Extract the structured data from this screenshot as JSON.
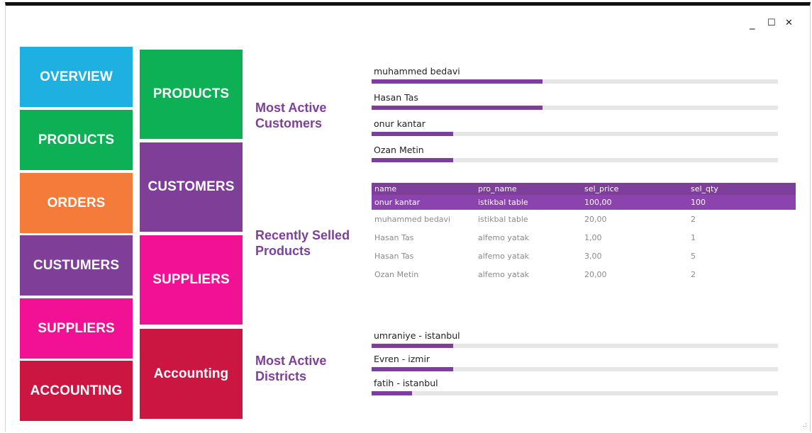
{
  "window_controls": {
    "minimize": "_",
    "maximize": "☐",
    "close": "✕"
  },
  "nav_left": [
    {
      "label": "OVERVIEW",
      "color": "#1fb0e2"
    },
    {
      "label": "PRODUCTS",
      "color": "#0eb055"
    },
    {
      "label": "ORDERS",
      "color": "#f47b3a"
    },
    {
      "label": "CUSTUMERS",
      "color": "#7f3f99"
    },
    {
      "label": "SUPPLIERS",
      "color": "#f21194"
    },
    {
      "label": "ACCOUNTING",
      "color": "#cc1642"
    }
  ],
  "nav_right": [
    {
      "label": "PRODUCTS",
      "color": "#0eb055"
    },
    {
      "label": "CUSTOMERS",
      "color": "#7f3f99"
    },
    {
      "label": "SUPPLIERS",
      "color": "#f21194"
    },
    {
      "label": "Accounting",
      "color": "#cc1642"
    }
  ],
  "sections": {
    "customers_title": "Most Active\nCustomers",
    "recent_title": "Recently Selled\nProducts",
    "districts_title": "Most Active\nDistricts"
  },
  "bar_color": "#7e3f9b",
  "active_customers": [
    {
      "name": "muhammed bedavi",
      "level": 0.42
    },
    {
      "name": "Hasan Tas",
      "level": 0.42
    },
    {
      "name": "onur kantar",
      "level": 0.2
    },
    {
      "name": "Ozan Metin",
      "level": 0.2
    }
  ],
  "recent_products": {
    "columns": [
      "name",
      "pro_name",
      "sel_price",
      "sel_qty"
    ],
    "rows": [
      [
        "onur kantar",
        "istikbal table",
        "100,00",
        "100"
      ],
      [
        "muhammed bedavi",
        "istikbal table",
        "20,00",
        "2"
      ],
      [
        "Hasan Tas",
        "alfemo yatak",
        "1,00",
        "1"
      ],
      [
        "Hasan Tas",
        "alfemo yatak",
        "3,00",
        "5"
      ],
      [
        "Ozan Metin",
        "alfemo yatak",
        "20,00",
        "2"
      ]
    ],
    "selected_row": 0
  },
  "active_districts": [
    {
      "name": "umraniye - istanbul",
      "level": 0.2
    },
    {
      "name": "Evren - izmir",
      "level": 0.2
    },
    {
      "name": "fatih - istanbul",
      "level": 0.1
    }
  ],
  "resize_grip": ".:"
}
